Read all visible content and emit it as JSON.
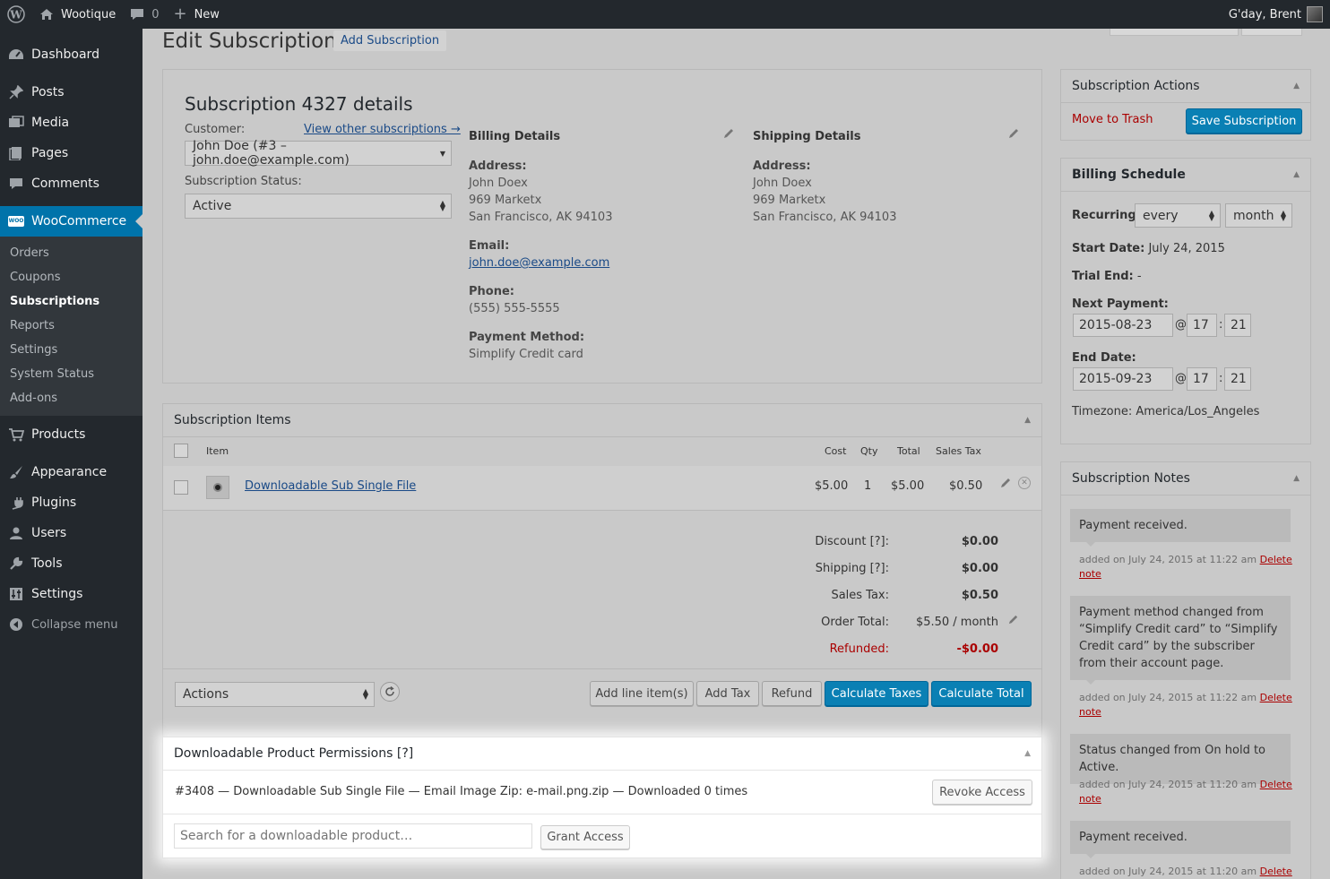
{
  "admin_bar": {
    "site_name": "Wootique",
    "comments_count": "0",
    "new_label": "New",
    "greeting": "G'day, Brent"
  },
  "sidebar": {
    "items": [
      "Dashboard",
      "Posts",
      "Media",
      "Pages",
      "Comments",
      "WooCommerce",
      "Products",
      "Appearance",
      "Plugins",
      "Users",
      "Tools",
      "Settings",
      "Collapse menu"
    ],
    "woo_submenu": [
      "Orders",
      "Coupons",
      "Subscriptions",
      "Reports",
      "Settings",
      "System Status",
      "Add-ons"
    ]
  },
  "page": {
    "title": "Edit Subscription",
    "add_button": "Add Subscription"
  },
  "details": {
    "heading": "Subscription 4327 details",
    "customer_label": "Customer:",
    "view_other": "View other subscriptions →",
    "customer_value": "John Doe (#3 – john.doe@example.com)",
    "status_label": "Subscription Status:",
    "status_value": "Active",
    "billing": {
      "title": "Billing Details",
      "address_label": "Address:",
      "name": "John Doex",
      "street": "969 Marketx",
      "city": "San Francisco, AK 94103",
      "email_label": "Email:",
      "email": "john.doe@example.com",
      "phone_label": "Phone:",
      "phone": "(555) 555-5555",
      "payment_label": "Payment Method:",
      "payment": "Simplify Credit card"
    },
    "shipping": {
      "title": "Shipping Details",
      "address_label": "Address:",
      "name": "John Doex",
      "street": "969 Marketx",
      "city": "San Francisco, AK 94103"
    }
  },
  "items": {
    "title": "Subscription Items",
    "columns": {
      "item": "Item",
      "cost": "Cost",
      "qty": "Qty",
      "total": "Total",
      "tax": "Sales Tax"
    },
    "row": {
      "name": "Downloadable Sub Single File",
      "cost": "$5.00",
      "qty": "1",
      "total": "$5.00",
      "tax": "$0.50"
    },
    "totals": [
      {
        "label": "Discount [?]:",
        "value": "$0.00"
      },
      {
        "label": "Shipping [?]:",
        "value": "$0.00"
      },
      {
        "label": "Sales Tax:",
        "value": "$0.50"
      },
      {
        "label": "Order Total:",
        "value": "$5.50 / month"
      },
      {
        "label": "Refunded:",
        "value": "-$0.00"
      }
    ],
    "actions_select": "Actions",
    "buttons": {
      "add_line": "Add line item(s)",
      "add_tax": "Add Tax",
      "refund": "Refund",
      "calc_taxes": "Calculate Taxes",
      "calc_total": "Calculate Total"
    }
  },
  "downloads": {
    "title": "Downloadable Product Permissions [?]",
    "entry": "#3408 — Downloadable Sub Single File — Email Image Zip: e-mail.png.zip — Downloaded 0 times",
    "revoke": "Revoke Access",
    "search_placeholder": "Search for a downloadable product…",
    "grant": "Grant Access"
  },
  "actions_box": {
    "title": "Subscription Actions",
    "trash": "Move to Trash",
    "save": "Save Subscription"
  },
  "schedule": {
    "title": "Billing Schedule",
    "recurring_label": "Recurring:",
    "interval": "every",
    "period": "month",
    "start_label": "Start Date:",
    "start_value": "July 24, 2015",
    "trial_label": "Trial End:",
    "trial_value": "-",
    "next_label": "Next Payment:",
    "next_date": "2015-08-23",
    "next_hour": "17",
    "next_min": "21",
    "end_label": "End Date:",
    "end_date": "2015-09-23",
    "end_hour": "17",
    "end_min": "21",
    "at": "@",
    "colon": ":",
    "timezone": "Timezone: America/Los_Angeles"
  },
  "notes": {
    "title": "Subscription Notes",
    "list": [
      {
        "text": "Payment received.",
        "meta": "added on July 24, 2015 at 11:22 am"
      },
      {
        "text": "Payment method changed from “Simplify Credit card” to “Simplify Credit card” by the subscriber from their account page.",
        "meta": "added on July 24, 2015 at 11:22 am"
      },
      {
        "text": "Status changed from On hold to Active.",
        "meta": "added on July 24, 2015 at 11:20 am"
      },
      {
        "text": "Payment received.",
        "meta": "added on July 24, 2015 at 11:20 am"
      }
    ],
    "delete": "Delete",
    "note": "note"
  }
}
